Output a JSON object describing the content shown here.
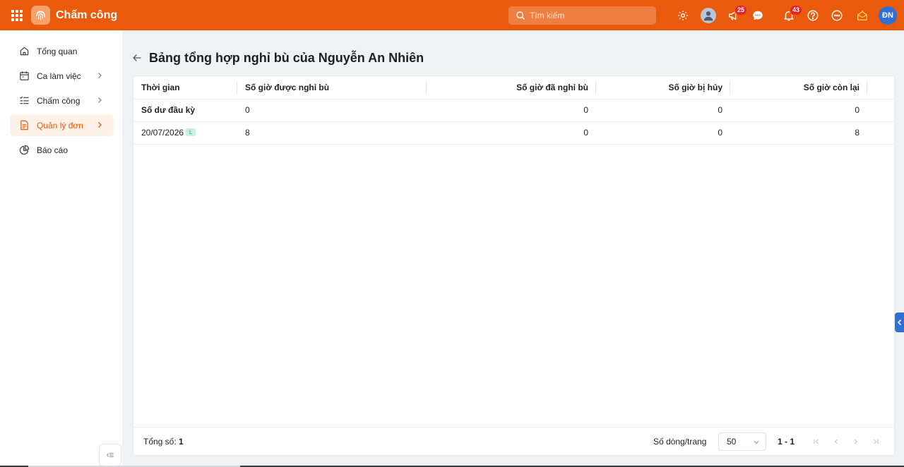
{
  "app": {
    "title": "Chấm công"
  },
  "search": {
    "placeholder": "Tìm kiếm"
  },
  "top_icons": {
    "settings_icon": "gear-icon",
    "announcement_badge": "25",
    "notification_badge": "43",
    "user_initials": "ĐN"
  },
  "sidebar": {
    "items": [
      {
        "label": "Tổng quan",
        "icon": "home-icon",
        "has_chevron": false,
        "active": false
      },
      {
        "label": "Ca làm việc",
        "icon": "calendar-icon",
        "has_chevron": true,
        "active": false
      },
      {
        "label": "Chấm công",
        "icon": "checklist-icon",
        "has_chevron": true,
        "active": false
      },
      {
        "label": "Quản lý đơn",
        "icon": "document-icon",
        "has_chevron": true,
        "active": true
      },
      {
        "label": "Báo cáo",
        "icon": "pie-chart-icon",
        "has_chevron": false,
        "active": false
      }
    ]
  },
  "page": {
    "title": "Bảng tổng hợp nghỉ bù của Nguyễn An Nhiên"
  },
  "table": {
    "columns": [
      "Thời gian",
      "Số giờ được nghỉ bù",
      "Số giờ đã nghỉ bù",
      "Số giờ bị hủy",
      "Số giờ còn lại"
    ],
    "rows": [
      {
        "time": "Số dư đầu kỳ",
        "time_bold": true,
        "tag": "",
        "earned": "0",
        "used": "0",
        "cancelled": "0",
        "remaining": "0"
      },
      {
        "time": "20/07/2026",
        "time_bold": false,
        "tag": "L",
        "earned": "8",
        "used": "0",
        "cancelled": "0",
        "remaining": "8"
      }
    ]
  },
  "footer": {
    "total_label": "Tổng số:",
    "total_value": "1",
    "rows_per_page_label": "Số dòng/trang",
    "rows_per_page_value": "50",
    "range": "1 - 1"
  },
  "colors": {
    "brand": "#ea5a0c",
    "active_bg": "#fdf1e8",
    "avatar": "#2f6fd6",
    "badge": "#e0262d"
  }
}
